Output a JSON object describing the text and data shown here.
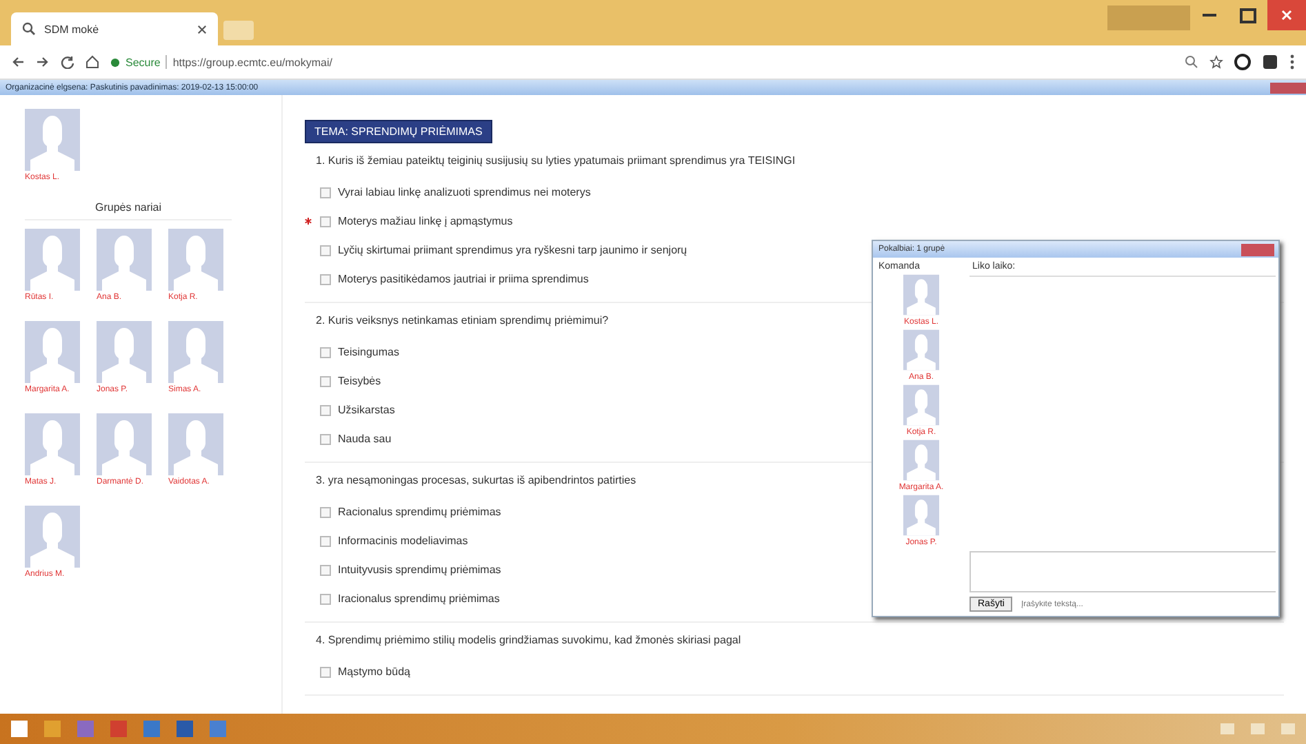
{
  "browser": {
    "tab_title": "SDM mokė",
    "secure_label": "Secure",
    "url": "https://group.ecmtc.eu/mokymai/"
  },
  "info_bar": {
    "text": "Organizacinė elgsena: Paskutinis pavadinimas: 2019-02-13 15:00:00"
  },
  "sidebar": {
    "teacher": {
      "name": "Kostas L."
    },
    "group_heading": "Grupės nariai",
    "members": [
      {
        "name": "Rūtas I."
      },
      {
        "name": "Ana B."
      },
      {
        "name": "Kotja R."
      },
      {
        "name": "Margarita A."
      },
      {
        "name": "Jonas P."
      },
      {
        "name": "Simas A."
      },
      {
        "name": "Matas J."
      },
      {
        "name": "Darmantė D."
      },
      {
        "name": "Vaidotas A."
      },
      {
        "name": "Andrius M."
      }
    ]
  },
  "topic": "TEMA: SPRENDIMŲ PRIĖMIMAS",
  "questions": [
    {
      "text": "1. Kuris iš žemiau pateiktų teiginių susijusių su lyties ypatumais priimant sprendimus yra TEISINGI",
      "options": [
        {
          "label": "Vyrai labiau linkę analizuoti sprendimus nei moterys",
          "checked": false,
          "marked": false
        },
        {
          "label": "Moterys mažiau linkę į apmąstymus",
          "checked": false,
          "marked": true
        },
        {
          "label": "Lyčių skirtumai priimant sprendimus yra ryškesni tarp jaunimo ir senjorų",
          "checked": false,
          "marked": false
        },
        {
          "label": "Moterys pasitikėdamos jautriai ir priima sprendimus",
          "checked": false,
          "marked": false
        }
      ]
    },
    {
      "text": "2. Kuris veiksnys netinkamas etiniam sprendimų priėmimui?",
      "options": [
        {
          "label": "Teisingumas",
          "checked": false,
          "marked": false
        },
        {
          "label": "Teisybės",
          "checked": false,
          "marked": false
        },
        {
          "label": "Užsikarstas",
          "checked": false,
          "marked": false
        },
        {
          "label": "Nauda sau",
          "checked": false,
          "marked": false
        }
      ]
    },
    {
      "text": "3. yra nesąmoningas procesas, sukurtas iš apibendrintos patirties",
      "options": [
        {
          "label": "Racionalus sprendimų priėmimas",
          "checked": false,
          "marked": false
        },
        {
          "label": "Informacinis modeliavimas",
          "checked": false,
          "marked": false
        },
        {
          "label": "Intuityvusis sprendimų priėmimas",
          "checked": false,
          "marked": false
        },
        {
          "label": "Iracionalus sprendimų priėmimas",
          "checked": false,
          "marked": false
        }
      ]
    },
    {
      "text": "4. Sprendimų priėmimo stilių modelis grindžiamas suvokimu, kad žmonės skiriasi pagal",
      "options": [
        {
          "label": "Mąstymo būdą",
          "checked": false,
          "marked": false
        }
      ]
    }
  ],
  "chat": {
    "title": "Pokalbiai: 1 grupė",
    "team_label": "Komanda",
    "time_label": "Liko laiko:",
    "members": [
      {
        "name": "Kostas L."
      },
      {
        "name": "Ana B."
      },
      {
        "name": "Kotja R."
      },
      {
        "name": "Margarita A."
      },
      {
        "name": "Jonas P."
      }
    ],
    "send_button": "Rašyti",
    "placeholder": "Įrašykite tekstą..."
  }
}
